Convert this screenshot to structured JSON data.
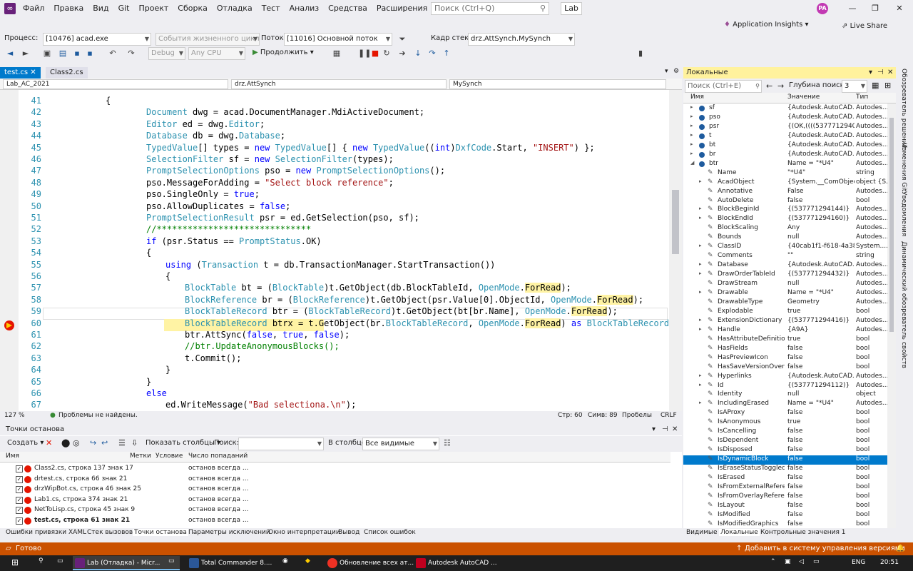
{
  "menu": {
    "items": [
      "Файл",
      "Правка",
      "Вид",
      "Git",
      "Проект",
      "Сборка",
      "Отладка",
      "Тест",
      "Анализ",
      "Средства",
      "Расширения",
      "Окно",
      "Справка"
    ],
    "search_placeholder": "Поиск (Ctrl+Q)",
    "solution": "Lab",
    "avatar": "PA"
  },
  "toolbar1": {
    "process_label": "Процесс:",
    "process": "[10476] acad.exe",
    "lifecycle": "События жизненного цикла",
    "thread_label": "Поток:",
    "thread": "[11016] Основной поток",
    "stack_label": "Кадр стека:",
    "stack": "drz.AttSynch.MySynch",
    "app_insights": "Application Insights",
    "live_share": "Live Share"
  },
  "toolbar2": {
    "config": "Debug",
    "platform": "Any CPU",
    "continue": "Продолжить"
  },
  "editor": {
    "tabs": [
      "test.cs",
      "Class2.cs"
    ],
    "nav": [
      "Lab_AC_2021",
      "drz.AttSynch",
      "MySynch"
    ],
    "lines": [
      {
        "n": "41",
        "t": "{"
      },
      {
        "n": "42",
        "t": "Document dwg = acad.DocumentManager.MdiActiveDocument;"
      },
      {
        "n": "43",
        "t": "Editor ed = dwg.Editor;"
      },
      {
        "n": "44",
        "t": "Database db = dwg.Database;"
      },
      {
        "n": "45",
        "t": "TypedValue[] types = new TypedValue[] { new TypedValue((int)DxfCode.Start, \"INSERT\") };"
      },
      {
        "n": "46",
        "t": "SelectionFilter sf = new SelectionFilter(types);"
      },
      {
        "n": "47",
        "t": "PromptSelectionOptions pso = new PromptSelectionOptions();"
      },
      {
        "n": "48",
        "t": "pso.MessageForAdding = \"Select block reference\";"
      },
      {
        "n": "49",
        "t": "pso.SingleOnly = true;"
      },
      {
        "n": "50",
        "t": "pso.AllowDuplicates = false;"
      },
      {
        "n": "51",
        "t": "PromptSelectionResult psr = ed.GetSelection(pso, sf);"
      },
      {
        "n": "52",
        "t": "//******************************"
      },
      {
        "n": "53",
        "t": "if (psr.Status == PromptStatus.OK)"
      },
      {
        "n": "54",
        "t": "{"
      },
      {
        "n": "55",
        "t": "using (Transaction t = db.TransactionManager.StartTransaction())"
      },
      {
        "n": "56",
        "t": "{"
      },
      {
        "n": "57",
        "t": "BlockTable bt = (BlockTable)t.GetObject(db.BlockTableId, OpenMode.ForRead);"
      },
      {
        "n": "58",
        "t": "BlockReference br = (BlockReference)t.GetObject(psr.Value[0].ObjectId, OpenMode.ForRead);"
      },
      {
        "n": "59",
        "t": "BlockTableRecord btr = (BlockTableRecord)t.GetObject(bt[br.Name], OpenMode.ForRead);"
      },
      {
        "n": "60",
        "t": "BlockTableRecord btrx = t.GetObject(br.BlockTableRecord, OpenMode.ForRead) as BlockTableRecord;"
      },
      {
        "n": "61",
        "t": "btr.AttSync(false, true, false);"
      },
      {
        "n": "62",
        "t": "//btr.UpdateAnonymousBlocks();"
      },
      {
        "n": "63",
        "t": "t.Commit();"
      },
      {
        "n": "64",
        "t": "}"
      },
      {
        "n": "65",
        "t": "}"
      },
      {
        "n": "66",
        "t": "else"
      },
      {
        "n": "67",
        "t": "ed.WriteMessage(\"Bad selectiona.\\n\");"
      },
      {
        "n": "68",
        "t": "//******************************"
      }
    ],
    "zoom": "127 %",
    "problems": "Проблемы не найдены.",
    "pos_line": "Стр: 60",
    "pos_col": "Симв: 89",
    "spaces": "Пробелы",
    "eol": "CRLF"
  },
  "breakpoints": {
    "title": "Точки останова",
    "create": "Создать",
    "show_columns": "Показать столбцы",
    "search_label": "Поиск:",
    "in_column_label": "В столбце:",
    "in_column": "Все видимые",
    "columns": [
      "Имя",
      "Метки",
      "Условие",
      "Число попаданий"
    ],
    "rows": [
      {
        "name": "Class2.cs, строка 137 знак 17",
        "hits": "останов всегда ..."
      },
      {
        "name": "drtest.cs, строка 66 знак 21",
        "hits": "останов всегда ..."
      },
      {
        "name": "drzWipBot.cs, строка 46 знак 25",
        "hits": "останов всегда ..."
      },
      {
        "name": "Lab1.cs, строка 374 знак 21",
        "hits": "останов всегда ..."
      },
      {
        "name": "NetToLisp.cs, строка 45 знак 9",
        "hits": "останов всегда ..."
      },
      {
        "name": "test.cs, строка 61 знак 21",
        "hits": "останов всегда ..."
      }
    ],
    "tabs": [
      "Ошибки привязки XAML",
      "Стек вызовов",
      "Точки останова",
      "Параметры исключений",
      "Окно интерпретации",
      "Вывод",
      "Список ошибок"
    ]
  },
  "locals": {
    "title": "Локальные",
    "search_placeholder": "Поиск (Ctrl+E)",
    "depth_label": "Глубина поиска:",
    "depth": "3",
    "columns": [
      "Имя",
      "Значение",
      "Тип"
    ],
    "rows": [
      {
        "l": 0,
        "e": "▸",
        "n": "sf",
        "v": "{Autodesk.AutoCAD....",
        "t": "Autodes..."
      },
      {
        "l": 0,
        "e": "▸",
        "n": "pso",
        "v": "{Autodesk.AutoCAD....",
        "t": "Autodes..."
      },
      {
        "l": 0,
        "e": "▸",
        "n": "psr",
        "v": "{(OK,((((537771294000...",
        "t": "Autodes..."
      },
      {
        "l": 0,
        "e": "▸",
        "n": "t",
        "v": "{Autodesk.AutoCAD....",
        "t": "Autodes..."
      },
      {
        "l": 0,
        "e": "▸",
        "n": "bt",
        "v": "{Autodesk.AutoCAD....",
        "t": "Autodes..."
      },
      {
        "l": 0,
        "e": "▸",
        "n": "br",
        "v": "{Autodesk.AutoCAD....",
        "t": "Autodes..."
      },
      {
        "l": 0,
        "e": "◢",
        "n": "btr",
        "v": "Name = \"*U4\"",
        "t": "Autodes..."
      },
      {
        "l": 1,
        "e": "",
        "n": "Name",
        "v": "\"*U4\"",
        "t": "string"
      },
      {
        "l": 1,
        "e": "▸",
        "n": "AcadObject",
        "v": "{System.__ComObject}",
        "t": "object {S..."
      },
      {
        "l": 1,
        "e": "",
        "n": "Annotative",
        "v": "False",
        "t": "Autodes..."
      },
      {
        "l": 1,
        "e": "",
        "n": "AutoDelete",
        "v": "false",
        "t": "bool"
      },
      {
        "l": 1,
        "e": "▸",
        "n": "BlockBeginId",
        "v": "{(537771294144)}",
        "t": "Autodes..."
      },
      {
        "l": 1,
        "e": "▸",
        "n": "BlockEndId",
        "v": "{(537771294160)}",
        "t": "Autodes..."
      },
      {
        "l": 1,
        "e": "",
        "n": "BlockScaling",
        "v": "Any",
        "t": "Autodes..."
      },
      {
        "l": 1,
        "e": "",
        "n": "Bounds",
        "v": "null",
        "t": "Autodes..."
      },
      {
        "l": 1,
        "e": "▸",
        "n": "ClassID",
        "v": "{40cab1f1-f618-4a38...",
        "t": "System...."
      },
      {
        "l": 1,
        "e": "",
        "n": "Comments",
        "v": "\"\"",
        "t": "string"
      },
      {
        "l": 1,
        "e": "▸",
        "n": "Database",
        "v": "{Autodesk.AutoCAD....",
        "t": "Autodes..."
      },
      {
        "l": 1,
        "e": "▸",
        "n": "DrawOrderTableId",
        "v": "{(537771294432)}",
        "t": "Autodes..."
      },
      {
        "l": 1,
        "e": "",
        "n": "DrawStream",
        "v": "null",
        "t": "Autodes..."
      },
      {
        "l": 1,
        "e": "▸",
        "n": "Drawable",
        "v": "Name = \"*U4\"",
        "t": "Autodes..."
      },
      {
        "l": 1,
        "e": "",
        "n": "DrawableType",
        "v": "Geometry",
        "t": "Autodes..."
      },
      {
        "l": 1,
        "e": "",
        "n": "Explodable",
        "v": "true",
        "t": "bool"
      },
      {
        "l": 1,
        "e": "▸",
        "n": "ExtensionDictionary",
        "v": "{(537771294416)}",
        "t": "Autodes..."
      },
      {
        "l": 1,
        "e": "▸",
        "n": "Handle",
        "v": "{A9A}",
        "t": "Autodes..."
      },
      {
        "l": 1,
        "e": "",
        "n": "HasAttributeDefinitio...",
        "v": "true",
        "t": "bool"
      },
      {
        "l": 1,
        "e": "",
        "n": "HasFields",
        "v": "false",
        "t": "bool"
      },
      {
        "l": 1,
        "e": "",
        "n": "HasPreviewIcon",
        "v": "false",
        "t": "bool"
      },
      {
        "l": 1,
        "e": "",
        "n": "HasSaveVersionOverr...",
        "v": "false",
        "t": "bool"
      },
      {
        "l": 1,
        "e": "▸",
        "n": "Hyperlinks",
        "v": "{Autodesk.AutoCAD....",
        "t": "Autodes..."
      },
      {
        "l": 1,
        "e": "▸",
        "n": "Id",
        "v": "{(537771294112)}",
        "t": "Autodes..."
      },
      {
        "l": 1,
        "e": "",
        "n": "Identity",
        "v": "null",
        "t": "object"
      },
      {
        "l": 1,
        "e": "▸",
        "n": "IncludingErased",
        "v": "Name = \"*U4\"",
        "t": "Autodes..."
      },
      {
        "l": 1,
        "e": "",
        "n": "IsAProxy",
        "v": "false",
        "t": "bool"
      },
      {
        "l": 1,
        "e": "",
        "n": "IsAnonymous",
        "v": "true",
        "t": "bool"
      },
      {
        "l": 1,
        "e": "",
        "n": "IsCancelling",
        "v": "false",
        "t": "bool"
      },
      {
        "l": 1,
        "e": "",
        "n": "IsDependent",
        "v": "false",
        "t": "bool"
      },
      {
        "l": 1,
        "e": "",
        "n": "IsDisposed",
        "v": "false",
        "t": "bool"
      },
      {
        "l": 1,
        "e": "",
        "n": "IsDynamicBlock",
        "v": "false",
        "t": "bool",
        "sel": true
      },
      {
        "l": 1,
        "e": "",
        "n": "IsEraseStatusToggled",
        "v": "false",
        "t": "bool"
      },
      {
        "l": 1,
        "e": "",
        "n": "IsErased",
        "v": "false",
        "t": "bool"
      },
      {
        "l": 1,
        "e": "",
        "n": "IsFromExternalRefere...",
        "v": "false",
        "t": "bool"
      },
      {
        "l": 1,
        "e": "",
        "n": "IsFromOverlayRefere...",
        "v": "false",
        "t": "bool"
      },
      {
        "l": 1,
        "e": "",
        "n": "IsLayout",
        "v": "false",
        "t": "bool"
      },
      {
        "l": 1,
        "e": "",
        "n": "IsModified",
        "v": "false",
        "t": "bool"
      },
      {
        "l": 1,
        "e": "",
        "n": "IsModifiedGraphics",
        "v": "false",
        "t": "bool"
      }
    ],
    "tabs": [
      "Видимые",
      "Локальные",
      "Контрольные значения 1"
    ]
  },
  "side_tabs": [
    "Обозреватель решений",
    "Изменения Git",
    "Уведомления",
    "Динамический обозреватель свойств"
  ],
  "status": {
    "ready": "Готово",
    "vcs": "Добавить в систему управления версиями"
  },
  "taskbar": {
    "items": [
      "Lab (Отладка) - Micr...",
      "Total Commander 8....",
      "Обновление всех ат...",
      "Autodesk AutoCAD ..."
    ],
    "lang": "ENG",
    "time": "20:51"
  },
  "colors": {
    "accent": "#007acc",
    "status": "#ca5100",
    "breakpoint": "#e51400"
  }
}
